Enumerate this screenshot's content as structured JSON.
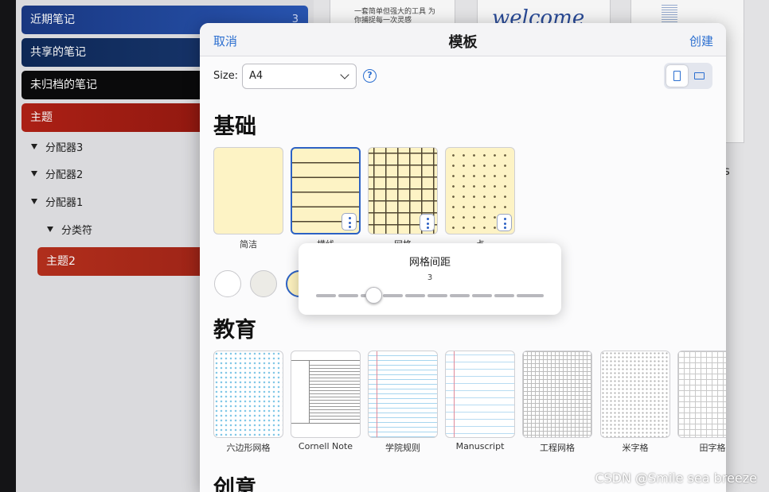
{
  "sidebar": {
    "items": [
      {
        "label": "近期笔记",
        "count": "3",
        "color": "#1e3f8a"
      },
      {
        "label": "共享的笔记",
        "color": "#102a55"
      },
      {
        "label": "未归档的笔记",
        "color": "#0a0a0a"
      },
      {
        "label": "主题",
        "color": "#a51c12"
      }
    ],
    "tree": [
      {
        "label": "分配器3"
      },
      {
        "label": "分配器2"
      },
      {
        "label": "分配器1"
      },
      {
        "label": "分类符"
      }
    ],
    "selected_topic": {
      "label": "主题2",
      "color": "#a8281a"
    }
  },
  "background": {
    "doc_text": "一套简单但强大的工具 为你捕捉每一次灵感",
    "cursive": "welcome",
    "edge_letter": "s"
  },
  "modal": {
    "cancel": "取消",
    "title": "模板",
    "create": "创建",
    "size_label": "Size:",
    "size_value": "A4",
    "help": "?",
    "accent": "#2c6fd0"
  },
  "sections": {
    "basic": {
      "title": "基础",
      "templates": [
        "简洁",
        "横线",
        "网格",
        "点"
      ]
    },
    "education": {
      "title": "教育",
      "templates": [
        "六边形网格",
        "Cornell Note",
        "学院规则",
        "Manuscript",
        "工程网格",
        "米字格",
        "田字格"
      ]
    },
    "creative": {
      "title": "创意"
    }
  },
  "popover": {
    "title": "网格间距",
    "value": "3",
    "slider_level": 0.25
  },
  "watermark": "CSDN @Smile sea breeze"
}
